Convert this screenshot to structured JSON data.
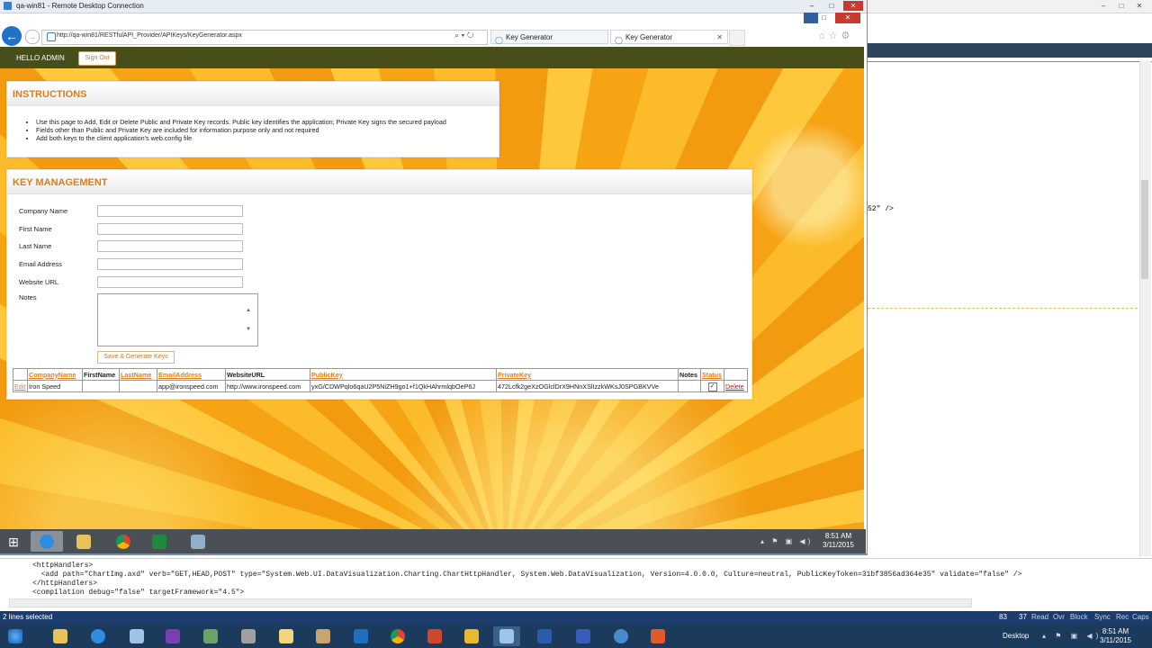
{
  "rdc": {
    "title": "qa-win81 - Remote Desktop Connection",
    "controls": [
      "–",
      "□",
      "✕"
    ]
  },
  "browser": {
    "url": "http://qa-win81/RESTfulAPI_Provider/APIKeys/KeyGenerator.aspx",
    "address_icons": "⌕ ▾ ↻",
    "tabs": [
      {
        "label": "Key Generator"
      },
      {
        "label": "Key Generator"
      }
    ],
    "tab_close": "✕",
    "tools": "⌂☆⚙"
  },
  "site": {
    "hello": "HELLO ADMIN",
    "sign_out": "Sign Out"
  },
  "instructions": {
    "title": "INSTRUCTIONS",
    "items": [
      "Use this page to Add, Edit or Delete Public and Private Key records. Public key identifies the application; Private Key signs the secured payload",
      "Fields other than Public and Private Key are included for information purpose only and not required",
      "Add both keys to the client application's web.config file"
    ]
  },
  "key_management": {
    "title": "KEY MANAGEMENT",
    "fields": {
      "company": {
        "label": "Company Name",
        "value": ""
      },
      "first": {
        "label": "First Name",
        "value": ""
      },
      "last": {
        "label": "Last Name",
        "value": ""
      },
      "email": {
        "label": "Email Address",
        "value": ""
      },
      "website": {
        "label": "Website URL",
        "value": ""
      },
      "notes": {
        "label": "Notes",
        "value": ""
      }
    },
    "generate_button": "Save & Generate Keys",
    "table": {
      "headers": [
        "",
        "CompanyName",
        "FirstName",
        "LastName",
        "EmailAddress",
        "WebsiteURL",
        "PublicKey",
        "PrivateKey",
        "Notes",
        "Status",
        ""
      ],
      "rows": [
        {
          "edit": "Edit",
          "company": "Iron Speed",
          "first": "",
          "last": "",
          "email": "app@ironspeed.com",
          "website": "http://www.ironspeed.com",
          "public_key": "yxG/CDWPqlo6qaU2P5NiZH9go1+f1QkHAhrmlqbOeP6J",
          "private_key": "472Lcfk2geXzOGlclDrX9HNnXSlIzzkWKsJ0SPGBKVVe",
          "notes": "",
          "status_checked": true,
          "delete": "Delete"
        }
      ]
    }
  },
  "remote_taskbar": {
    "time": "8:51 AM",
    "date": "3/11/2015",
    "tray": "▴ ⚑ ▣ ◀)"
  },
  "host": {
    "code_fragment": "52\" />",
    "code_lines": [
      "<httpHandlers>",
      "  <add path=\"ChartImg.axd\" verb=\"GET,HEAD,POST\" type=\"System.Web.UI.DataVisualization.Charting.ChartHttpHandler, System.Web.DataVisualization, Version=4.0.0.0, Culture=neutral, PublicKeyToken=31bf3856ad364e35\" validate=\"false\" />",
      "</httpHandlers>",
      "<compilation debug=\"false\" targetFramework=\"4.5\">"
    ],
    "status_left": "2 lines selected",
    "status_line": "83",
    "status_col": "37",
    "status_flags": [
      "Read",
      "Ovr",
      "Block",
      "Sync",
      "Rec",
      "Caps"
    ],
    "desktop_label": "Desktop",
    "tray": "▴ ⚑ ▣ ◀)",
    "time": "8:51 AM",
    "date": "3/11/2015",
    "window_controls": [
      "–",
      "□",
      "✕"
    ]
  },
  "colors": {
    "accent_orange": "#e37c16",
    "header_olive": "#474e1a",
    "delete_red": "#d01010"
  }
}
